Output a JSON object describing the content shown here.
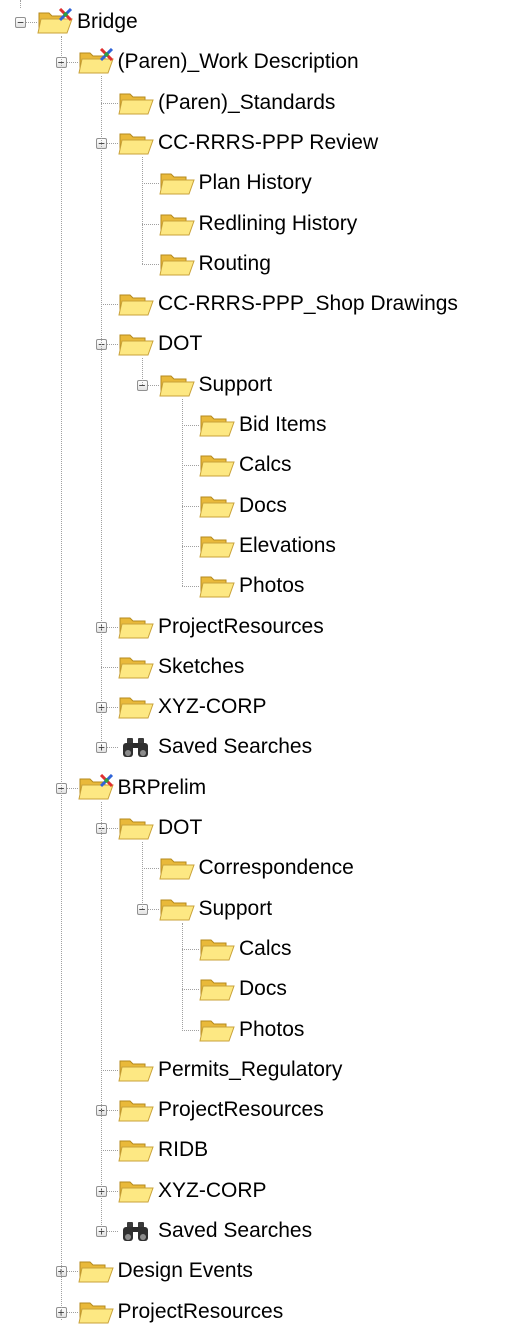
{
  "tree": [
    {
      "label": "Bridge",
      "depth": 0,
      "icon": "project-folder-icon",
      "state": "expanded",
      "children": [
        {
          "label": "(Paren)_Work Description",
          "depth": 1,
          "icon": "project-folder-icon",
          "state": "expanded",
          "children": [
            {
              "label": "(Paren)_Standards",
              "depth": 2,
              "icon": "folder-icon",
              "state": "leaf"
            },
            {
              "label": "CC-RRRS-PPP Review",
              "depth": 2,
              "icon": "folder-icon",
              "state": "expanded",
              "children": [
                {
                  "label": "Plan History",
                  "depth": 3,
                  "icon": "folder-icon",
                  "state": "leaf"
                },
                {
                  "label": "Redlining History",
                  "depth": 3,
                  "icon": "folder-icon",
                  "state": "leaf"
                },
                {
                  "label": "Routing",
                  "depth": 3,
                  "icon": "folder-icon",
                  "state": "leaf"
                }
              ]
            },
            {
              "label": "CC-RRRS-PPP_Shop Drawings",
              "depth": 2,
              "icon": "folder-icon",
              "state": "leaf"
            },
            {
              "label": "DOT",
              "depth": 2,
              "icon": "folder-icon",
              "state": "expanded",
              "children": [
                {
                  "label": "Support",
                  "depth": 3,
                  "icon": "folder-icon",
                  "state": "expanded",
                  "children": [
                    {
                      "label": "Bid Items",
                      "depth": 4,
                      "icon": "folder-icon",
                      "state": "leaf"
                    },
                    {
                      "label": "Calcs",
                      "depth": 4,
                      "icon": "folder-icon",
                      "state": "leaf"
                    },
                    {
                      "label": "Docs",
                      "depth": 4,
                      "icon": "folder-icon",
                      "state": "leaf"
                    },
                    {
                      "label": "Elevations",
                      "depth": 4,
                      "icon": "folder-icon",
                      "state": "leaf"
                    },
                    {
                      "label": "Photos",
                      "depth": 4,
                      "icon": "folder-icon",
                      "state": "leaf"
                    }
                  ]
                }
              ]
            },
            {
              "label": "ProjectResources",
              "depth": 2,
              "icon": "folder-icon",
              "state": "collapsed"
            },
            {
              "label": "Sketches",
              "depth": 2,
              "icon": "folder-icon",
              "state": "leaf"
            },
            {
              "label": "XYZ-CORP",
              "depth": 2,
              "icon": "folder-icon",
              "state": "collapsed"
            },
            {
              "label": "Saved Searches",
              "depth": 2,
              "icon": "binoculars-icon",
              "state": "collapsed"
            }
          ]
        },
        {
          "label": "BRPrelim",
          "depth": 1,
          "icon": "project-folder-icon",
          "state": "expanded",
          "children": [
            {
              "label": "DOT",
              "depth": 2,
              "icon": "folder-icon",
              "state": "expanded",
              "children": [
                {
                  "label": "Correspondence",
                  "depth": 3,
                  "icon": "folder-icon",
                  "state": "leaf"
                },
                {
                  "label": "Support",
                  "depth": 3,
                  "icon": "folder-icon",
                  "state": "expanded",
                  "children": [
                    {
                      "label": "Calcs",
                      "depth": 4,
                      "icon": "folder-icon",
                      "state": "leaf"
                    },
                    {
                      "label": "Docs",
                      "depth": 4,
                      "icon": "folder-icon",
                      "state": "leaf"
                    },
                    {
                      "label": "Photos",
                      "depth": 4,
                      "icon": "folder-icon",
                      "state": "leaf"
                    }
                  ]
                }
              ]
            },
            {
              "label": "Permits_Regulatory",
              "depth": 2,
              "icon": "folder-icon",
              "state": "leaf"
            },
            {
              "label": "ProjectResources",
              "depth": 2,
              "icon": "folder-icon",
              "state": "collapsed"
            },
            {
              "label": "RIDB",
              "depth": 2,
              "icon": "folder-icon",
              "state": "leaf"
            },
            {
              "label": "XYZ-CORP",
              "depth": 2,
              "icon": "folder-icon",
              "state": "collapsed"
            },
            {
              "label": "Saved Searches",
              "depth": 2,
              "icon": "binoculars-icon",
              "state": "collapsed"
            }
          ]
        },
        {
          "label": "Design Events",
          "depth": 1,
          "icon": "folder-icon",
          "state": "collapsed"
        },
        {
          "label": "ProjectResources",
          "depth": 1,
          "icon": "folder-icon",
          "state": "collapsed"
        }
      ]
    }
  ],
  "colors": {
    "folder_back": "#e9b93a",
    "folder_front": "#fde883",
    "tree_lines": "#a0a0a0",
    "project_badge_red": "#e03030",
    "project_badge_green": "#2ea043",
    "project_badge_blue": "#2f63d8"
  }
}
